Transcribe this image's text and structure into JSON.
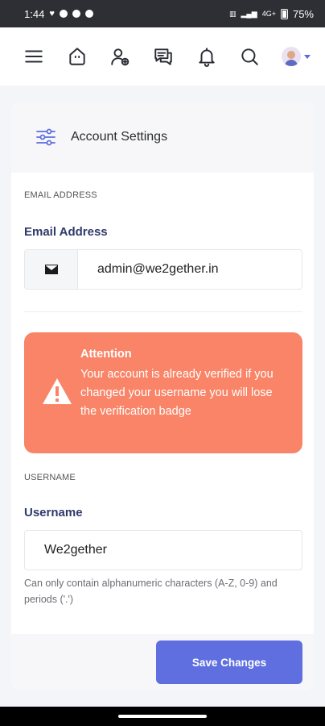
{
  "status_bar": {
    "time": "1:44",
    "network": "4G+",
    "battery": "75%"
  },
  "nav": {
    "icons": [
      "menu-icon",
      "home-icon",
      "add-user-icon",
      "messages-icon",
      "bell-icon",
      "search-icon",
      "avatar"
    ]
  },
  "card": {
    "title": "Account Settings",
    "email_section_label": "EMAIL ADDRESS",
    "email_field_label": "Email Address",
    "email_value": "admin@we2gether.in",
    "alert_title": "Attention",
    "alert_text": "Your account is already verified if you changed your username you will lose the verification badge",
    "username_section_label": "USERNAME",
    "username_field_label": "Username",
    "username_value": "We2gether",
    "username_help": "Can only contain alphanumeric characters (A-Z, 0-9) and periods ('.')",
    "save_label": "Save Changes"
  },
  "colors": {
    "accent": "#5f6fe0",
    "alert": "#f98467",
    "label": "#2e3a6b"
  }
}
